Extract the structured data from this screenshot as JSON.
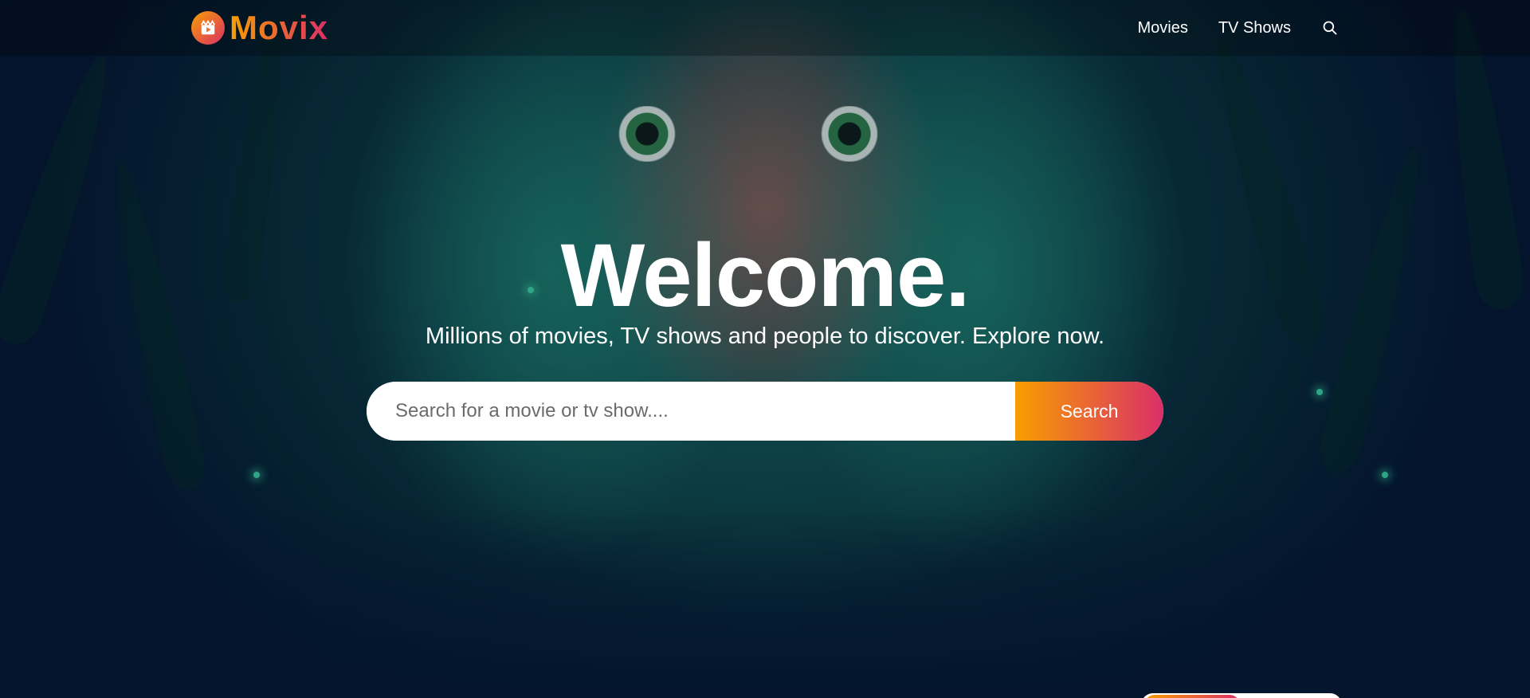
{
  "app": {
    "logo_text": "Movix",
    "logo_icon": "clapperboard-play-icon"
  },
  "nav": {
    "items": [
      "Movies",
      "TV Shows"
    ],
    "search_icon": "search-icon"
  },
  "hero": {
    "title": "Welcome.",
    "subtitle": "Millions of movies, TV shows and people to discover. Explore now.",
    "search": {
      "placeholder": "Search for a movie or tv show....",
      "value": "",
      "button_label": "Search"
    }
  },
  "colors": {
    "background": "#04152d",
    "accent_start": "#f89e00",
    "accent_end": "#da2f68"
  }
}
